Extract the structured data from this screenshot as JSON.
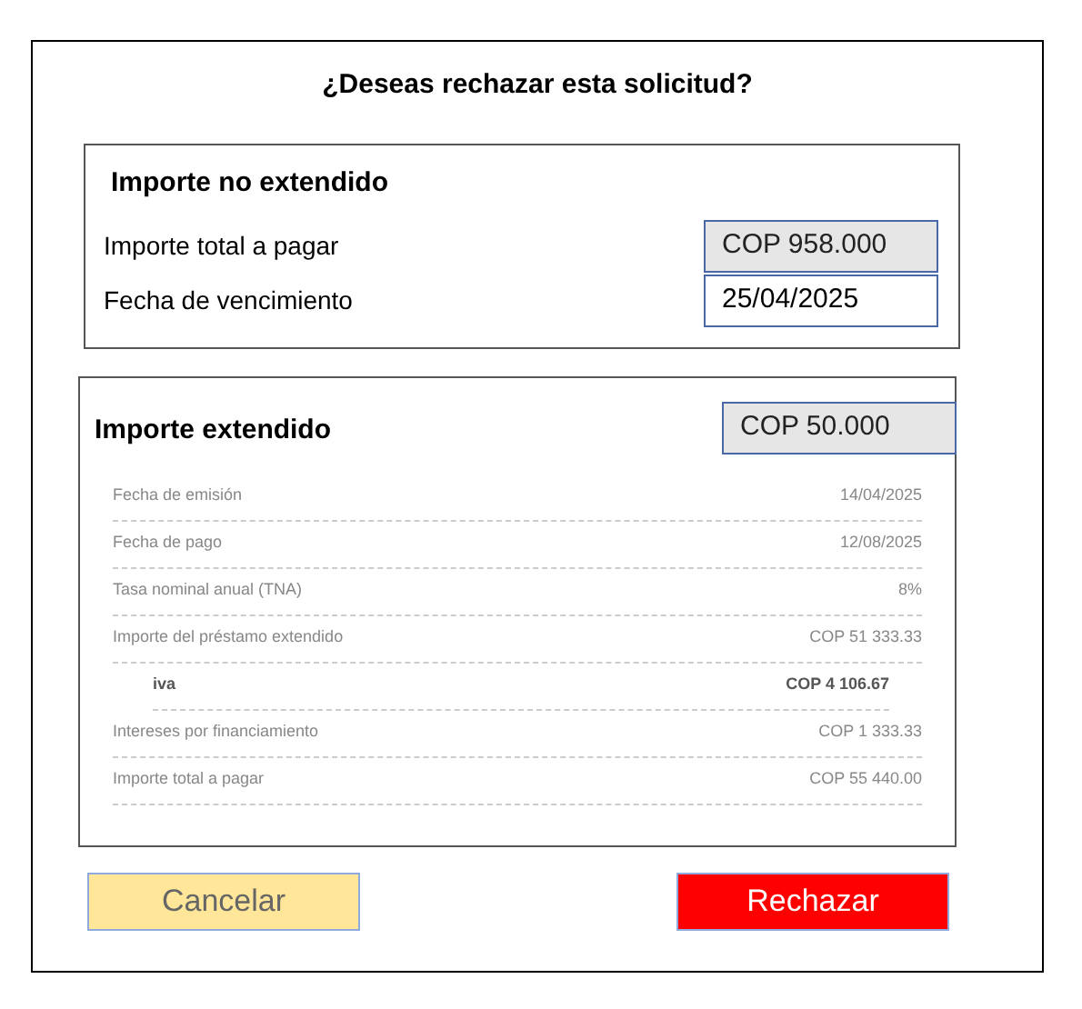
{
  "title": "¿Deseas rechazar esta solicitud?",
  "not_extended": {
    "heading": "Importe no extendido",
    "fields": [
      {
        "label": "Importe total a pagar",
        "value": "COP 958.000",
        "kind": "readonly"
      },
      {
        "label": "Fecha de vencimiento",
        "value": "25/04/2025",
        "kind": "editable"
      }
    ]
  },
  "extended": {
    "heading": "Importe extendido",
    "amount": "COP 50.000",
    "rows": [
      {
        "label": "Fecha de emisión",
        "value": "14/04/2025",
        "kind": "normal"
      },
      {
        "label": "Fecha de pago",
        "value": "12/08/2025",
        "kind": "normal"
      },
      {
        "label": "Tasa nominal anual (TNA)",
        "value": "8%",
        "kind": "normal"
      },
      {
        "label": "Importe del préstamo extendido",
        "value": "COP 51 333.33",
        "kind": "normal"
      },
      {
        "label": "iva",
        "value": "COP 4 106.67",
        "kind": "sub"
      },
      {
        "label": "Intereses por financiamiento",
        "value": "COP 1 333.33",
        "kind": "normal"
      },
      {
        "label": "Importe total a pagar",
        "value": "COP 55 440.00",
        "kind": "normal"
      }
    ]
  },
  "buttons": [
    {
      "label": "Cancelar",
      "kind": "secondary"
    },
    {
      "label": "Rechazar",
      "kind": "danger"
    }
  ]
}
